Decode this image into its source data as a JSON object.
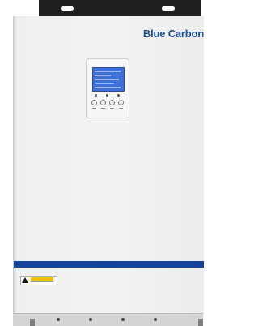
{
  "brand": {
    "name": "Blue Carbon",
    "color": "#1c4f9c"
  },
  "device": {
    "type": "wall-mounted solar inverter",
    "housing_color": "#f2f2f2",
    "stripe_color": "#16439a",
    "bracket_color": "#1f1f1f",
    "display_color": "#3f6fd8"
  },
  "control_panel": {
    "button_count": 4,
    "indicator_count": 3
  },
  "warning_label": {
    "banner_color": "#f2c200",
    "icon": "warning-triangle-icon"
  }
}
